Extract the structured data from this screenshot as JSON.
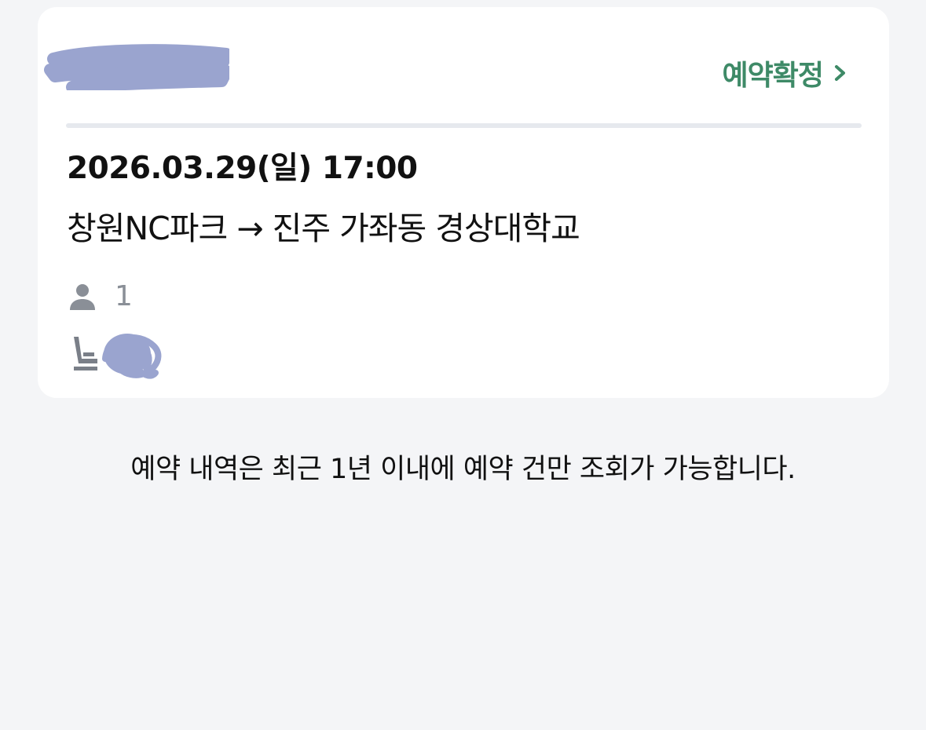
{
  "card": {
    "status_label": "예약확정",
    "status_color": "#3e8a67",
    "icons": {
      "status": "chevron-right-icon",
      "passenger": "person-icon",
      "seat": "seat-icon"
    },
    "datetime": "2026.03.29(일) 17:00",
    "route": "창원NC파크 → 진주 가좌동 경상대학교",
    "passenger_count": "1"
  },
  "notice": "예약 내역은 최근 1년 이내에 예약 건만 조회가 가능합니다.",
  "colors": {
    "background": "#f4f5f7",
    "card": "#ffffff",
    "redaction": "#9aa4cf",
    "muted_icon": "#8a8f97"
  }
}
